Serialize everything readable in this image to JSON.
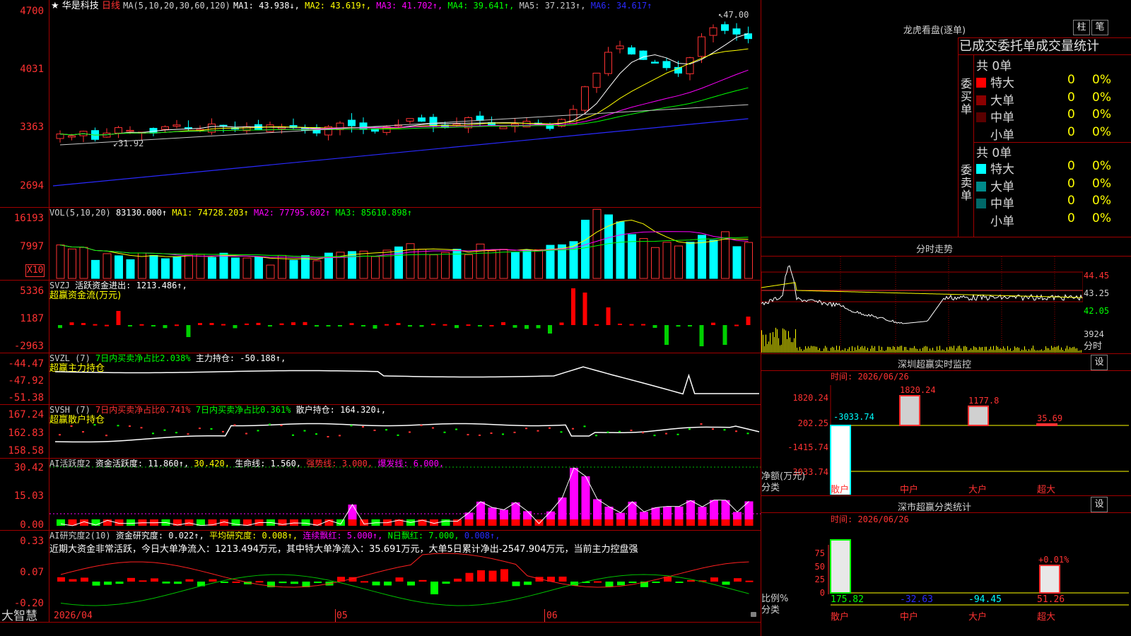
{
  "kline_header": {
    "prefix": "★",
    "stock": "华是科技",
    "period": "日线",
    "ma_params": "MA(5,10,20,30,60,120)",
    "ma_vals": [
      {
        "t": "MA1: 43.938↓",
        "c": "#ffffff"
      },
      {
        "t": "MA2: 43.619↑",
        "c": "#ffff00"
      },
      {
        "t": "MA3: 41.702↑",
        "c": "#ff00ff"
      },
      {
        "t": "MA4: 39.641↑",
        "c": "#00ff00"
      },
      {
        "t": "MA5: 37.213↑",
        "c": "#c8c8c8"
      },
      {
        "t": "MA6: 34.617↑",
        "c": "#2a2aff"
      }
    ]
  },
  "kline_axis": [
    "4700",
    "4031",
    "3363",
    "2694"
  ],
  "kline_marks": {
    "high": "47.00",
    "low": "31.92"
  },
  "vol_header": {
    "label": "VOL(5,10,20)",
    "val": "83130.000↑",
    "ma1": "MA1: 74728.203↑",
    "ma2": "MA2: 77795.602↑",
    "ma3": "MA3: 85610.898↑"
  },
  "vol_axis": [
    "16193",
    "7997"
  ],
  "vol_unit": "X10",
  "svzj_header": {
    "label": "SVZJ",
    "desc": "活跃资金进出: 1213.486↑,",
    "sub": "超赢资金流(万元)"
  },
  "svzj_axis": [
    "5336",
    "1187",
    "-2963"
  ],
  "svzl_header": {
    "label": "SVZL (7)",
    "a": "7日内买卖净占比2.038%",
    "b": "主力持仓: -50.188↑,",
    "sub": "超赢主力持仓"
  },
  "svzl_axis": [
    "-44.47",
    "-47.92",
    "-51.38"
  ],
  "svsh_header": {
    "label": "SVSH (7)",
    "a": "7日内买卖净占比0.741%",
    "b": "7日内买卖净占比0.361%",
    "c": "散户持仓: 164.320↓,",
    "sub": "超赢散户持仓"
  },
  "svsh_axis": [
    "167.24",
    "162.83",
    "158.58"
  ],
  "ai1_header": {
    "label": "AI活跃度2",
    "a": "资金活跃度: 11.860↑,",
    "b": "30.420,",
    "c": "生命线: 1.560,",
    "d": "强势线: 3.000,",
    "e": "爆发线: 6.000,"
  },
  "ai1_axis": [
    "30.42",
    "15.03",
    "0.00"
  ],
  "ai2_header": {
    "label": "AI研究度2(10)",
    "a": "资金研究度: 0.022↑,",
    "b": "平均研究度: 0.008↑,",
    "c": "连续飘红: 5.000↑,",
    "d": "N日飘红: 7.000,",
    "e": "0.008↑,"
  },
  "ai2_summary": "近期大资金非常活跃，今日大单净流入：1213.494万元，其中特大单净流入：35.691万元，大单5日累计净出-2547.904万元，当前主力控盘强",
  "ai2_axis": [
    "0.33",
    "0.07",
    "-0.20"
  ],
  "bottom": {
    "brand": "大智慧",
    "date": "2026/04",
    "m05": "05",
    "m06": "06"
  },
  "dragon": {
    "title": "龙虎看盘(逐单)",
    "btn_bar": "柱",
    "btn_pen": "笔",
    "sub": "已成交委托单成交量统计",
    "buy": {
      "label": "委买单",
      "total": "共 0单",
      "rows": [
        {
          "name": "特大",
          "v": "0",
          "p": "0%",
          "c": "#ff0000"
        },
        {
          "name": "大单",
          "v": "0",
          "p": "0%",
          "c": "#8b0000"
        },
        {
          "name": "中单",
          "v": "0",
          "p": "0%",
          "c": "#5a0000"
        },
        {
          "name": "小单",
          "v": "0",
          "p": "0%",
          "c": "#000000"
        }
      ]
    },
    "sell": {
      "label": "委卖单",
      "total": "共 0单",
      "rows": [
        {
          "name": "特大",
          "v": "0",
          "p": "0%",
          "c": "#00ffff"
        },
        {
          "name": "大单",
          "v": "0",
          "p": "0%",
          "c": "#008b8b"
        },
        {
          "name": "中单",
          "v": "0",
          "p": "0%",
          "c": "#006868"
        },
        {
          "name": "小单",
          "v": "0",
          "p": "0%",
          "c": "#000000"
        }
      ]
    }
  },
  "minute": {
    "title": "分时走势",
    "axis": [
      "44.45",
      "43.25",
      "42.05",
      "3924",
      "分时"
    ]
  },
  "sz_monitor": {
    "title": "深圳超赢实时监控",
    "btn": "设",
    "time": "时间: 2026/06/26",
    "axis": [
      "1820.24",
      "202.25",
      "-1415.74",
      "-3033.74"
    ],
    "ylabel": "净额(万元)",
    "xlabel": "分类",
    "cats": [
      "散户",
      "中户",
      "大户",
      "超大"
    ],
    "values": [
      "-3033.74",
      "1820.24",
      "1177.8",
      "35.69"
    ]
  },
  "sz_class": {
    "title": "深市超赢分类统计",
    "btn": "设",
    "time": "时间: 2026/06/26",
    "axis": [
      "75",
      "50",
      "25",
      "0"
    ],
    "ylabel": "比例%",
    "xlabel": "分类",
    "cats": [
      "散户",
      "中户",
      "大户",
      "超大"
    ],
    "values": [
      "175.82",
      "-32.63",
      "-94.45",
      "51.26"
    ],
    "mark": "+0.01%"
  }
}
